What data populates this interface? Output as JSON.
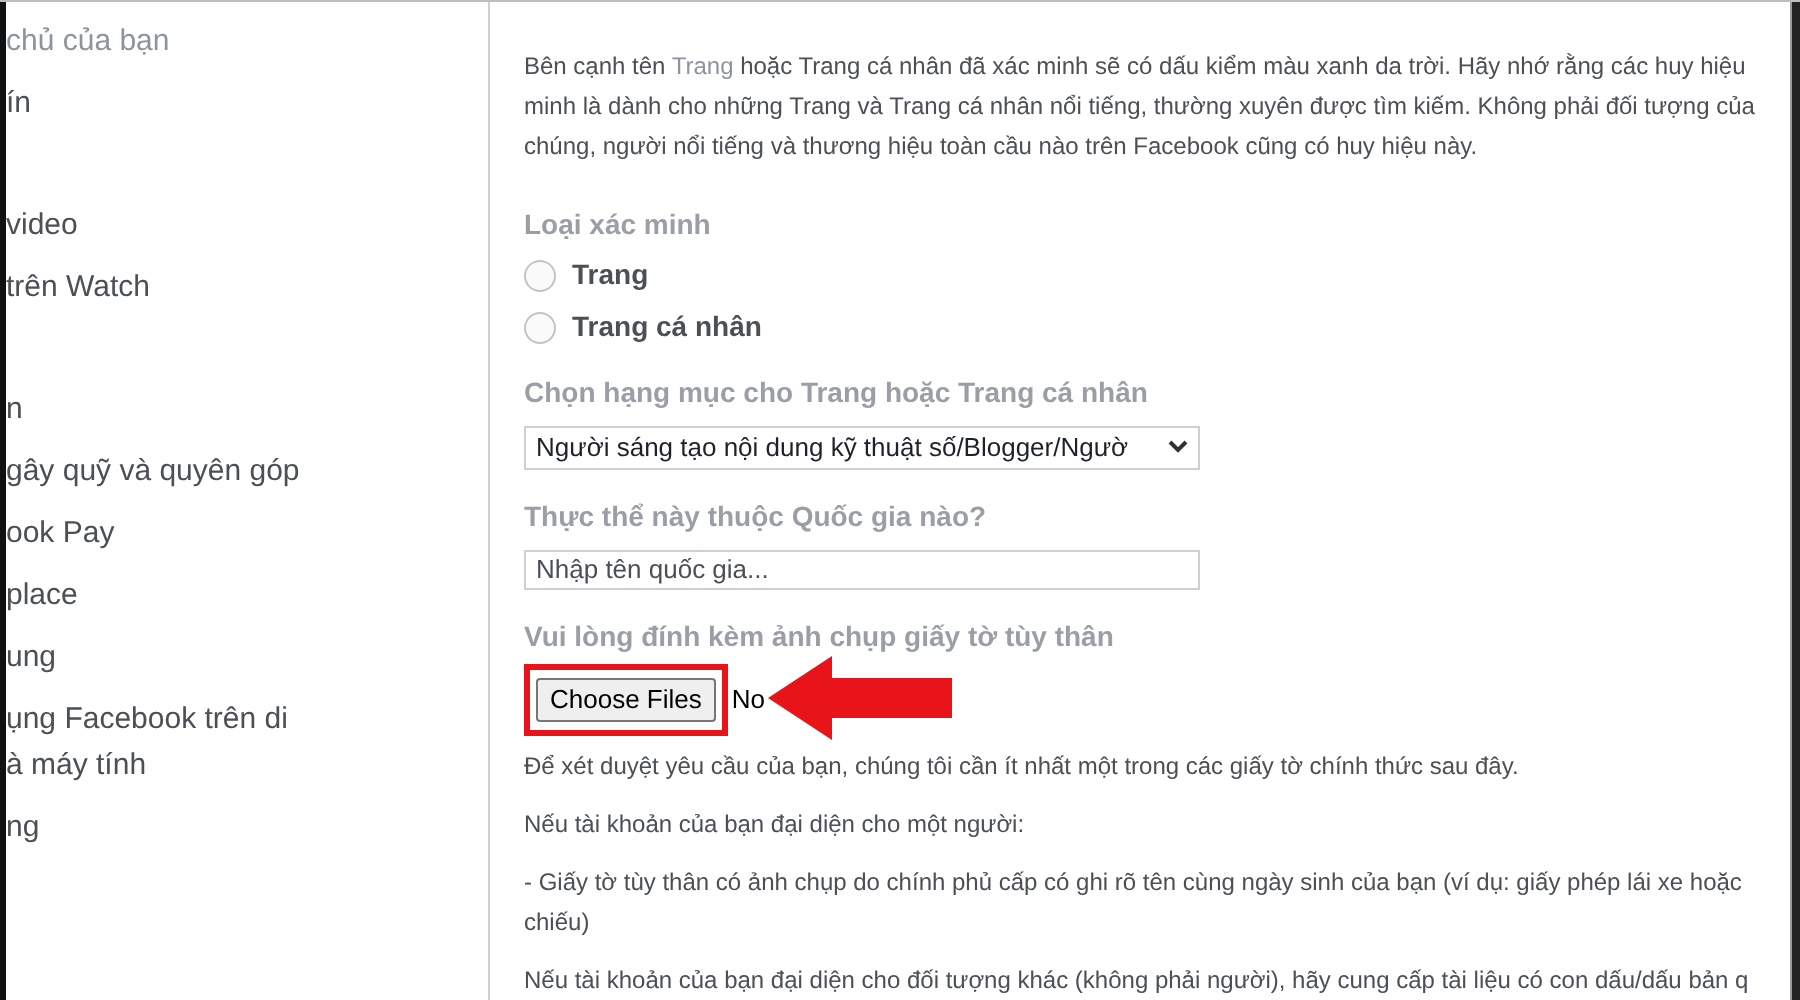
{
  "sidebar": {
    "groups": [
      {
        "items": [
          {
            "lines": [
              "chủ của bạn"
            ],
            "dimmed": true
          },
          {
            "lines": [
              "ín"
            ],
            "dimmed": false
          }
        ]
      },
      {
        "items": [
          {
            "lines": [
              "video"
            ],
            "dimmed": false
          },
          {
            "lines": [
              "trên Watch"
            ],
            "dimmed": false
          }
        ]
      },
      {
        "items": [
          {
            "lines": [
              "n"
            ],
            "dimmed": false
          },
          {
            "lines": [
              "gây quỹ và quyên góp"
            ],
            "dimmed": false
          },
          {
            "lines": [
              "ook Pay"
            ],
            "dimmed": false
          },
          {
            "lines": [
              "place"
            ],
            "dimmed": false
          },
          {
            "lines": [
              "ung"
            ],
            "dimmed": false
          },
          {
            "lines": [
              "ụng Facebook trên di",
              "à máy tính"
            ],
            "dimmed": false
          },
          {
            "lines": [
              "ng"
            ],
            "dimmed": false
          }
        ]
      }
    ]
  },
  "intro": {
    "lines": [
      [
        {
          "text": "Bên cạnh tên "
        },
        {
          "text": "Trang",
          "link": true
        },
        {
          "text": " hoặc Trang cá nhân đã xác minh sẽ có dấu kiểm màu xanh da trời. Hãy nhớ rằng các huy hiệu"
        }
      ],
      [
        {
          "text": "minh là dành cho những Trang và Trang cá nhân nổi tiếng, thường xuyên được tìm kiếm. Không phải đối tượng của"
        }
      ],
      [
        {
          "text": "chúng, người nổi tiếng và thương hiệu toàn cầu nào trên Facebook cũng có huy hiệu này."
        }
      ]
    ]
  },
  "verification_type": {
    "label": "Loại xác minh",
    "options": [
      {
        "label": "Trang",
        "selected": false
      },
      {
        "label": "Trang cá nhân",
        "selected": false
      }
    ]
  },
  "category": {
    "label": "Chọn hạng mục cho Trang hoặc Trang cá nhân",
    "value": "Người sáng tạo nội dung kỹ thuật số/Blogger/Ngườ"
  },
  "country": {
    "label": "Thực thể này thuộc Quốc gia nào?",
    "placeholder": "Nhập tên quốc gia..."
  },
  "attachment": {
    "label": "Vui lòng đính kèm ảnh chụp giấy tờ tùy thân",
    "button": "Choose Files",
    "status": "No",
    "highlighted": true
  },
  "details": [
    {
      "lines": [
        "Để xét duyệt yêu cầu của bạn, chúng tôi cần ít nhất một trong các giấy tờ chính thức sau đây."
      ]
    },
    {
      "lines": [
        "Nếu tài khoản của bạn đại diện cho một người:"
      ]
    },
    {
      "lines": [
        "- Giấy tờ tùy thân có ảnh chụp do chính phủ cấp có ghi rõ tên cùng ngày sinh của bạn (ví dụ: giấy phép lái xe hoặc",
        "chiếu)"
      ]
    },
    {
      "lines": [
        "Nếu tài khoản của bạn đại diện cho đối tượng khác (không phải người), hãy cung cấp tài liệu có con dấu/dấu bản q"
      ]
    }
  ]
}
